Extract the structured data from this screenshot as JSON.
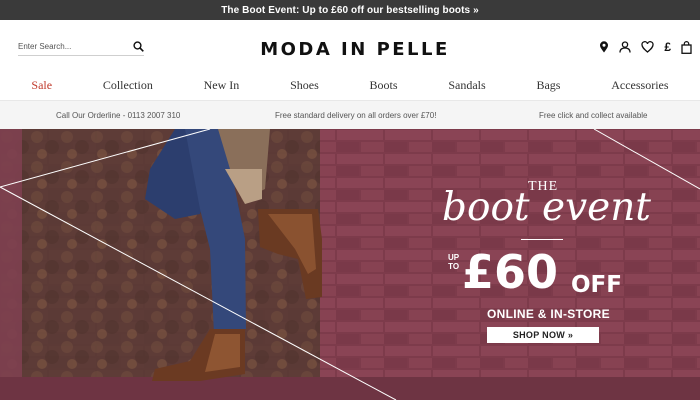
{
  "promo_bar": {
    "text": "The Boot Event: Up to £60 off our bestselling boots »"
  },
  "header": {
    "search": {
      "placeholder": "Enter Search..."
    },
    "brand": "MODA IN PELLE",
    "icons": [
      "location-pin-icon",
      "account-icon",
      "wishlist-heart-icon",
      "currency-pound",
      "shopping-bag-icon"
    ],
    "currency_symbol": "£"
  },
  "nav": {
    "items": [
      {
        "label": "Sale"
      },
      {
        "label": "Collection"
      },
      {
        "label": "New In"
      },
      {
        "label": "Shoes"
      },
      {
        "label": "Boots"
      },
      {
        "label": "Sandals"
      },
      {
        "label": "Bags"
      },
      {
        "label": "Accessories"
      }
    ],
    "sale_color": "#c0392b"
  },
  "usp": {
    "orderline": "Call Our Orderline - 0113 2007 310",
    "delivery": "Free standard delivery on all orders over £70!",
    "click_collect": "Free click and collect available"
  },
  "hero": {
    "the": "THE",
    "title": "boot event",
    "up_to_line1": "UP",
    "up_to_line2": "TO",
    "amount": "£60",
    "off": "OFF",
    "subline": "ONLINE & IN-STORE",
    "cta": "SHOP NOW »",
    "background_color": "#7a3a4a"
  }
}
